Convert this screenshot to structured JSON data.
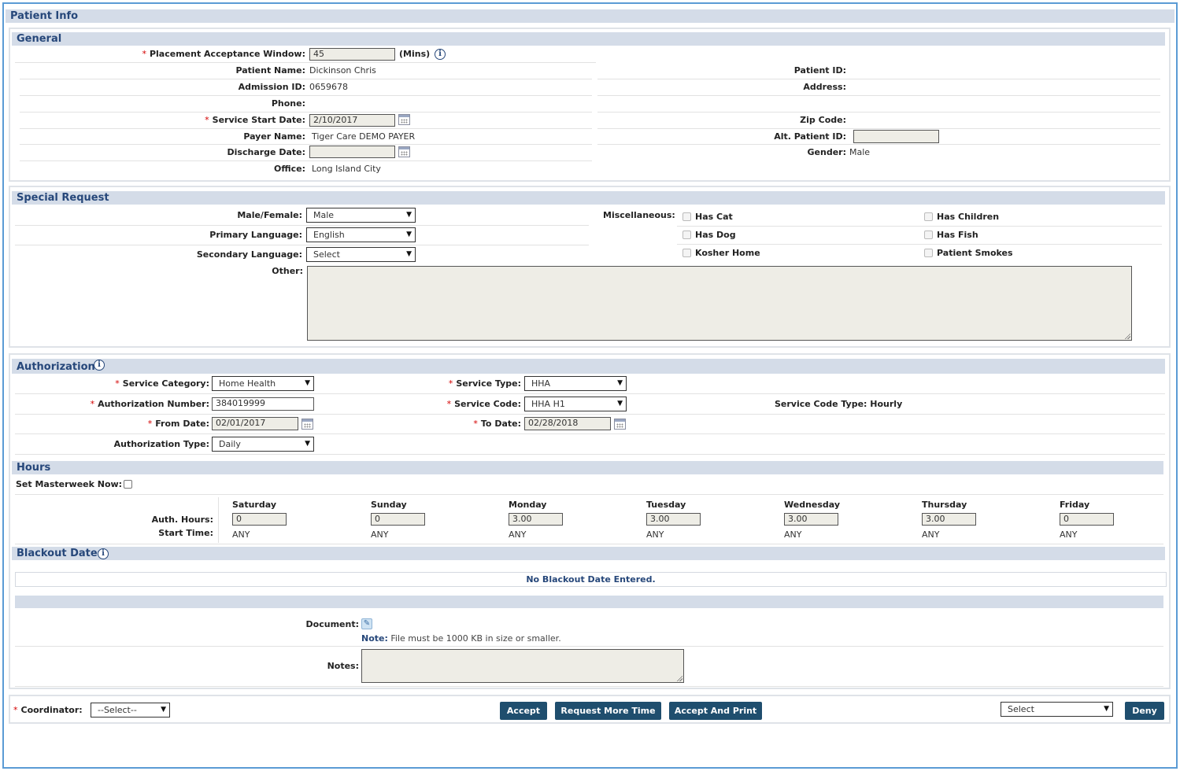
{
  "patient_info": {
    "title": "Patient Info"
  },
  "general": {
    "title": "General",
    "placement_label": "Placement Acceptance Window:",
    "placement_value": "45",
    "placement_unit": "(Mins)",
    "patient_name_label": "Patient Name:",
    "patient_name": "Dickinson Chris",
    "admission_id_label": "Admission ID:",
    "admission_id": "0659678",
    "phone_label": "Phone:",
    "service_start_label": "Service Start Date:",
    "service_start_value": "2/10/2017",
    "payer_name_label": "Payer Name:",
    "payer_name": "Tiger Care DEMO PAYER",
    "discharge_label": "Discharge Date:",
    "discharge_value": "",
    "office_label": "Office:",
    "office": "Long Island City",
    "patient_id_label": "Patient ID:",
    "address_label": "Address:",
    "zip_label": "Zip Code:",
    "alt_patient_id_label": "Alt. Patient ID:",
    "alt_patient_id_value": "",
    "gender_label": "Gender:",
    "gender": "Male"
  },
  "special_request": {
    "title": "Special Request",
    "male_female_label": "Male/Female:",
    "male_female_value": "Male",
    "primary_language_label": "Primary Language:",
    "primary_language_value": "English",
    "secondary_language_label": "Secondary Language:",
    "secondary_language_value": "Select",
    "other_label": "Other:",
    "misc_label": "Miscellaneous:",
    "misc_items": [
      "Has Cat",
      "Has Children",
      "Has Dog",
      "Has Fish",
      "Kosher Home",
      "Patient Smokes"
    ]
  },
  "authorization": {
    "title": "Authorization",
    "service_category_label": "Service Category:",
    "service_category_value": "Home Health",
    "service_type_label": "Service Type:",
    "service_type_value": "HHA",
    "auth_number_label": "Authorization Number:",
    "auth_number_value": "384019999",
    "service_code_label": "Service Code:",
    "service_code_value": "HHA H1",
    "service_code_type": "Service Code Type: Hourly",
    "from_date_label": "From Date:",
    "from_date_value": "02/01/2017",
    "to_date_label": "To Date:",
    "to_date_value": "02/28/2018",
    "auth_type_label": "Authorization Type:",
    "auth_type_value": "Daily"
  },
  "hours": {
    "title": "Hours",
    "set_masterweek_label": "Set Masterweek Now:",
    "auth_hours_label": "Auth. Hours:",
    "start_time_label": "Start Time:",
    "days": [
      {
        "name": "Saturday",
        "hours": "0",
        "start": "ANY"
      },
      {
        "name": "Sunday",
        "hours": "0",
        "start": "ANY"
      },
      {
        "name": "Monday",
        "hours": "3.00",
        "start": "ANY"
      },
      {
        "name": "Tuesday",
        "hours": "3.00",
        "start": "ANY"
      },
      {
        "name": "Wednesday",
        "hours": "3.00",
        "start": "ANY"
      },
      {
        "name": "Thursday",
        "hours": "3.00",
        "start": "ANY"
      },
      {
        "name": "Friday",
        "hours": "0",
        "start": "ANY"
      }
    ]
  },
  "blackout": {
    "title": "Blackout Dates",
    "empty_message": "No Blackout Date Entered."
  },
  "document": {
    "document_label": "Document:",
    "note_label": "Note:",
    "note_text": "File must be 1000 KB in size or smaller.",
    "notes_label": "Notes:"
  },
  "footer": {
    "coordinator_label": "Coordinator:",
    "coordinator_value": "--Select--",
    "accept_label": "Accept",
    "request_more_time_label": "Request More Time",
    "accept_and_print_label": "Accept And Print",
    "deny_reason_value": "Select",
    "deny_label": "Deny"
  },
  "colors": {
    "header_bg": "#d4dce8",
    "header_text": "#26477a",
    "button_bg": "#1f4e6e",
    "required": "#d40000",
    "frame": "#5b9bd5"
  }
}
